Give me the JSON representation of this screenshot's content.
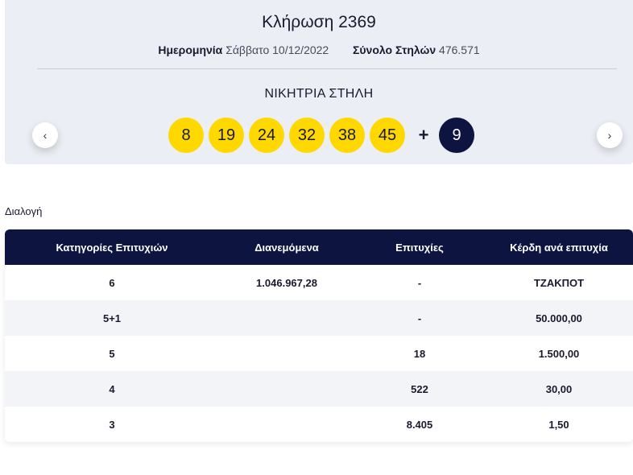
{
  "draw": {
    "title": "Κλήρωση 2369",
    "date_label": "Ημερομηνία",
    "date_value": "Σάββατο 10/12/2022",
    "columns_label": "Σύνολο Στηλών",
    "columns_value": "476.571",
    "winning_label": "ΝΙΚΗΤΡΙΑ ΣΤΗΛΗ",
    "numbers": [
      "8",
      "19",
      "24",
      "32",
      "38",
      "45"
    ],
    "plus": "+",
    "bonus": "9",
    "prev_icon": "‹",
    "next_icon": "›"
  },
  "colors": {
    "ball": "#ffd800",
    "bonus_ball": "#0d1440",
    "table_header": "#0d1440",
    "panel": "#eceef5"
  },
  "section_label": "Διαλογή",
  "table": {
    "headers": [
      "Κατηγορίες Επιτυχιών",
      "Διανεμόμενα",
      "Επιτυχίες",
      "Κέρδη ανά επιτυχία"
    ],
    "rows": [
      [
        "6",
        "1.046.967,28",
        "-",
        "ΤΖΑΚΠΟΤ"
      ],
      [
        "5+1",
        "",
        "-",
        "50.000,00"
      ],
      [
        "5",
        "",
        "18",
        "1.500,00"
      ],
      [
        "4",
        "",
        "522",
        "30,00"
      ],
      [
        "3",
        "",
        "8.405",
        "1,50"
      ]
    ]
  }
}
